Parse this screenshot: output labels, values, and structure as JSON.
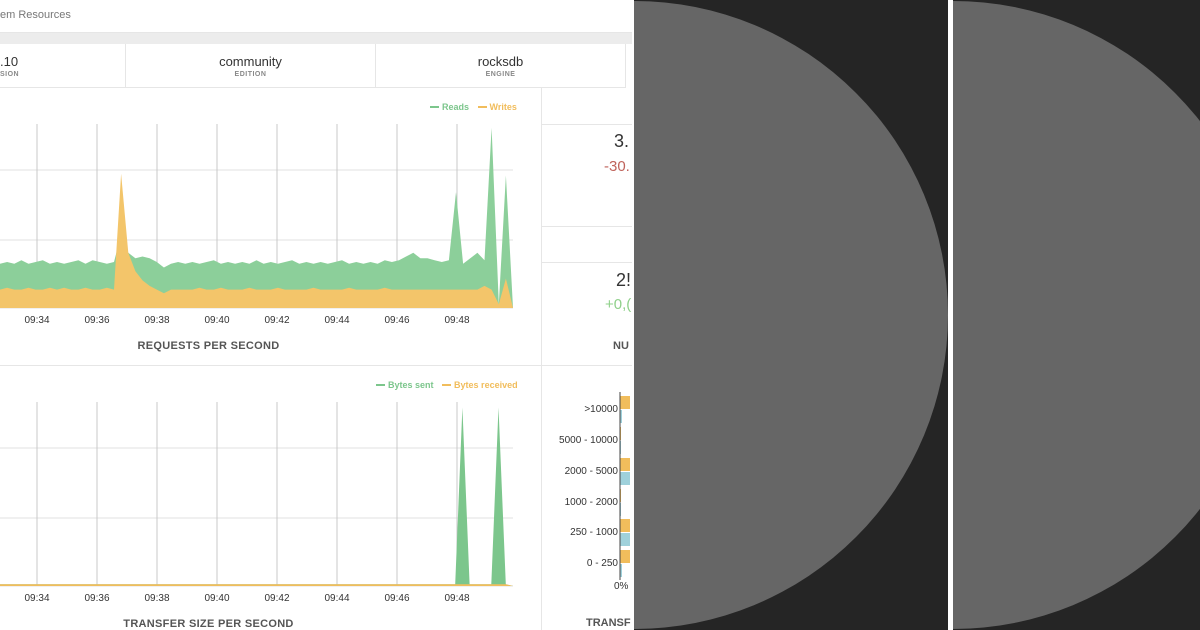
{
  "breadcrumb": "em Resources",
  "info_cards": [
    {
      "value": ".10",
      "label": "SION"
    },
    {
      "value": "community",
      "label": "EDITION"
    },
    {
      "value": "rocksdb",
      "label": "ENGINE"
    }
  ],
  "stats": [
    {
      "value": "3.",
      "delta": "-30.",
      "delta_color": "#c0645c"
    },
    {
      "value": "2!",
      "delta": "+0,(",
      "delta_color": "#8fd08a"
    }
  ],
  "stat_label": "NU",
  "requests_chart": {
    "title": "REQUESTS PER SECOND",
    "legend": [
      {
        "name": "Reads",
        "color": "#7cc68c"
      },
      {
        "name": "Writes",
        "color": "#f1bd5c"
      }
    ],
    "x_ticks": [
      "09:34",
      "09:36",
      "09:38",
      "09:40",
      "09:42",
      "09:44",
      "09:46",
      "09:48"
    ],
    "reads": [
      0.24,
      0.25,
      0.24,
      0.26,
      0.24,
      0.25,
      0.26,
      0.24,
      0.25,
      0.24,
      0.25,
      0.26,
      0.24,
      0.26,
      0.25,
      0.24,
      0.25,
      0.4,
      0.3,
      0.27,
      0.28,
      0.27,
      0.25,
      0.22,
      0.24,
      0.25,
      0.24,
      0.25,
      0.24,
      0.25,
      0.26,
      0.24,
      0.25,
      0.24,
      0.25,
      0.24,
      0.26,
      0.24,
      0.25,
      0.24,
      0.25,
      0.26,
      0.24,
      0.25,
      0.24,
      0.25,
      0.24,
      0.25,
      0.26,
      0.24,
      0.25,
      0.24,
      0.25,
      0.24,
      0.26,
      0.25,
      0.26,
      0.28,
      0.3,
      0.27,
      0.27,
      0.26,
      0.25,
      0.26,
      0.63,
      0.24,
      0.27,
      0.3,
      0.26,
      0.98,
      0.02,
      0.72,
      0.0
    ],
    "writes": [
      0.1,
      0.11,
      0.1,
      0.1,
      0.11,
      0.1,
      0.1,
      0.11,
      0.1,
      0.11,
      0.1,
      0.1,
      0.11,
      0.1,
      0.1,
      0.11,
      0.1,
      0.73,
      0.3,
      0.2,
      0.15,
      0.12,
      0.1,
      0.08,
      0.1,
      0.1,
      0.1,
      0.1,
      0.11,
      0.1,
      0.1,
      0.11,
      0.1,
      0.1,
      0.1,
      0.11,
      0.1,
      0.1,
      0.1,
      0.11,
      0.1,
      0.1,
      0.1,
      0.1,
      0.11,
      0.1,
      0.1,
      0.1,
      0.1,
      0.11,
      0.1,
      0.1,
      0.1,
      0.1,
      0.11,
      0.1,
      0.1,
      0.1,
      0.1,
      0.1,
      0.1,
      0.1,
      0.1,
      0.1,
      0.1,
      0.1,
      0.1,
      0.1,
      0.12,
      0.1,
      0.02,
      0.16,
      0.0
    ]
  },
  "transfer_chart": {
    "title": "TRANSFER SIZE PER SECOND",
    "legend": [
      {
        "name": "Bytes sent",
        "color": "#7cc68c"
      },
      {
        "name": "Bytes received",
        "color": "#f1bd5c"
      }
    ],
    "x_ticks": [
      "09:34",
      "09:36",
      "09:38",
      "09:40",
      "09:42",
      "09:44",
      "09:46",
      "09:48"
    ],
    "sent": [
      0.01,
      0.01,
      0.01,
      0.01,
      0.01,
      0.01,
      0.01,
      0.01,
      0.01,
      0.01,
      0.01,
      0.01,
      0.01,
      0.01,
      0.01,
      0.01,
      0.01,
      0.01,
      0.01,
      0.01,
      0.01,
      0.01,
      0.01,
      0.01,
      0.01,
      0.01,
      0.01,
      0.01,
      0.01,
      0.01,
      0.01,
      0.01,
      0.01,
      0.01,
      0.01,
      0.01,
      0.01,
      0.01,
      0.01,
      0.01,
      0.01,
      0.01,
      0.01,
      0.01,
      0.01,
      0.01,
      0.01,
      0.01,
      0.01,
      0.01,
      0.01,
      0.01,
      0.01,
      0.01,
      0.01,
      0.01,
      0.01,
      0.01,
      0.01,
      0.01,
      0.01,
      0.01,
      0.01,
      0.01,
      0.97,
      0.01,
      0.01,
      0.01,
      0.01,
      0.97,
      0.01,
      0.0
    ],
    "received": [
      0.01,
      0.01,
      0.01,
      0.01,
      0.01,
      0.01,
      0.01,
      0.01,
      0.01,
      0.01,
      0.01,
      0.01,
      0.01,
      0.01,
      0.01,
      0.01,
      0.01,
      0.01,
      0.01,
      0.01,
      0.01,
      0.01,
      0.01,
      0.01,
      0.01,
      0.01,
      0.01,
      0.01,
      0.01,
      0.01,
      0.01,
      0.01,
      0.01,
      0.01,
      0.01,
      0.01,
      0.01,
      0.01,
      0.01,
      0.01,
      0.01,
      0.01,
      0.01,
      0.01,
      0.01,
      0.01,
      0.01,
      0.01,
      0.01,
      0.01,
      0.01,
      0.01,
      0.01,
      0.01,
      0.01,
      0.01,
      0.01,
      0.01,
      0.01,
      0.01,
      0.01,
      0.01,
      0.01,
      0.01,
      0.01,
      0.01,
      0.01,
      0.01,
      0.01,
      0.01,
      0.01,
      0.0
    ]
  },
  "histogram": {
    "title": "TRANSF",
    "categories": [
      ">10000",
      "5000 - 10000",
      "2000 - 5000",
      "1000 - 2000",
      "250 - 1000",
      "0 - 250"
    ],
    "axis_label": "0%",
    "series": [
      {
        "color": "#f1bd5c",
        "values": [
          1,
          0.1,
          1,
          0.1,
          1,
          1
        ]
      },
      {
        "color": "#9fd1db",
        "values": [
          0.2,
          0.1,
          1,
          0.1,
          1,
          0.2
        ]
      }
    ]
  },
  "colors": {
    "panel_bg": "#252525",
    "circle": "#666666",
    "grid": "#e0e0e0",
    "vgrid": "#c8c8c8"
  }
}
